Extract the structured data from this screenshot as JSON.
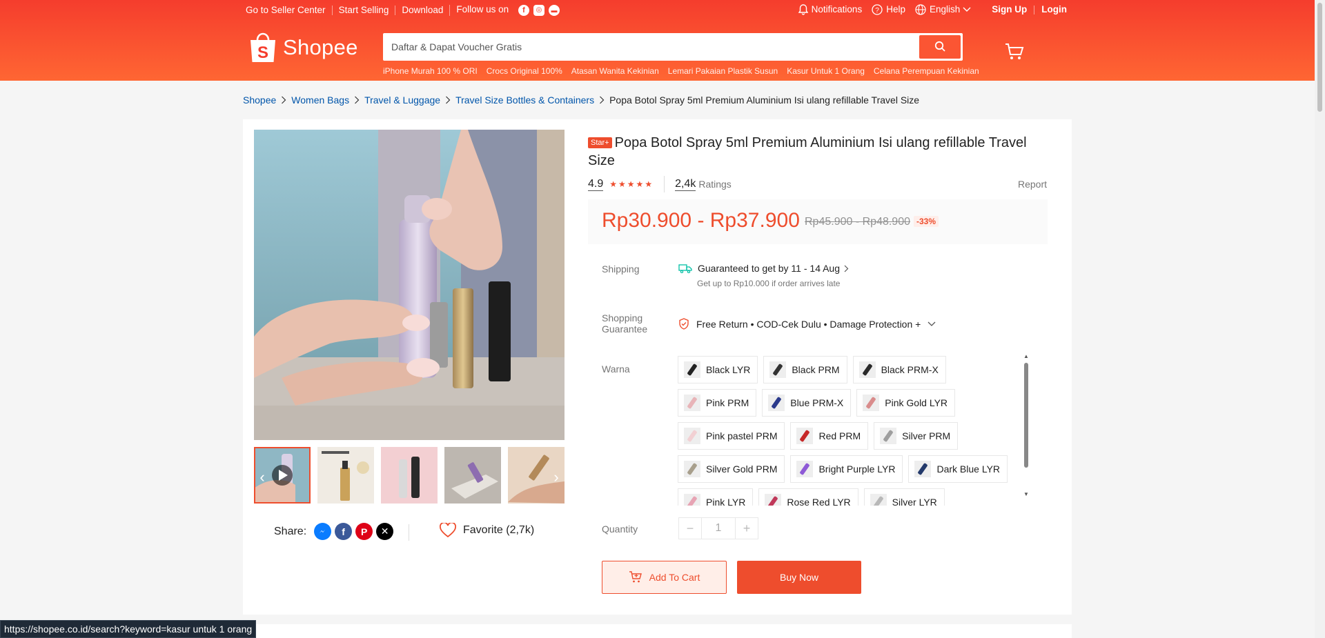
{
  "topbar": {
    "seller_center": "Go to Seller Center",
    "start_selling": "Start Selling",
    "download": "Download",
    "follow_us": "Follow us on",
    "notifications": "Notifications",
    "help": "Help",
    "language": "English",
    "sign_up": "Sign Up",
    "login": "Login"
  },
  "header": {
    "logo": "Shopee",
    "search_placeholder": "Daftar & Dapat Voucher Gratis",
    "suggestions": [
      "iPhone Murah 100 % ORI",
      "Crocs Original 100%",
      "Atasan Wanita Kekinian",
      "Lemari Pakaian Plastik Susun",
      "Kasur Untuk 1 Orang",
      "Celana Perempuan Kekinian"
    ]
  },
  "breadcrumb": [
    "Shopee",
    "Women Bags",
    "Travel & Luggage",
    "Travel Size Bottles & Containers"
  ],
  "breadcrumb_current": "Popa Botol Spray 5ml Premium Aluminium Isi ulang refillable Travel Size",
  "product": {
    "badge": "Star+",
    "title": "Popa Botol Spray 5ml Premium Aluminium Isi ulang refillable Travel Size",
    "rating": "4.9",
    "ratings_count": "2,4k",
    "ratings_label": "Ratings",
    "report": "Report",
    "price": "Rp30.900 - Rp37.900",
    "old_price": "Rp45.900 - Rp48.900",
    "discount": "-33%",
    "shipping_label": "Shipping",
    "shipping_text": "Guaranteed to get by 11 - 14 Aug",
    "shipping_sub": "Get up to Rp10.000 if order arrives late",
    "guarantee_label_1": "Shopping",
    "guarantee_label_2": "Guarantee",
    "guarantee_text": "Free Return • COD-Cek Dulu • Damage Protection +",
    "variant_label": "Warna",
    "variants": [
      {
        "label": "Black LYR",
        "color": "#222222"
      },
      {
        "label": "Black PRM",
        "color": "#333333"
      },
      {
        "label": "Black PRM-X",
        "color": "#2a2a2a"
      },
      {
        "label": "Pink PRM",
        "color": "#e8b4b8"
      },
      {
        "label": "Blue PRM-X",
        "color": "#2b3a8c"
      },
      {
        "label": "Pink Gold LYR",
        "color": "#d98c8c"
      },
      {
        "label": "Pink pastel PRM",
        "color": "#f2d0d3"
      },
      {
        "label": "Red PRM",
        "color": "#c62828"
      },
      {
        "label": "Silver PRM",
        "color": "#9e9e9e"
      },
      {
        "label": "Silver Gold PRM",
        "color": "#a89f8c"
      },
      {
        "label": "Bright Purple LYR",
        "color": "#8e5ad6"
      },
      {
        "label": "Dark Blue LYR",
        "color": "#243a6b"
      },
      {
        "label": "Pink LYR",
        "color": "#e7a4b4"
      },
      {
        "label": "Rose Red LYR",
        "color": "#c0395a"
      },
      {
        "label": "Silver LYR",
        "color": "#b8b8b8"
      }
    ],
    "quantity_label": "Quantity",
    "quantity_value": "1",
    "add_to_cart": "Add To Cart",
    "buy_now": "Buy Now",
    "share_label": "Share:",
    "favorite": "Favorite (2,7k)"
  },
  "status_url": "https://shopee.co.id/search?keyword=kasur untuk 1 orang",
  "colors": {
    "brand": "#ee4d2d",
    "link": "#0055aa"
  }
}
